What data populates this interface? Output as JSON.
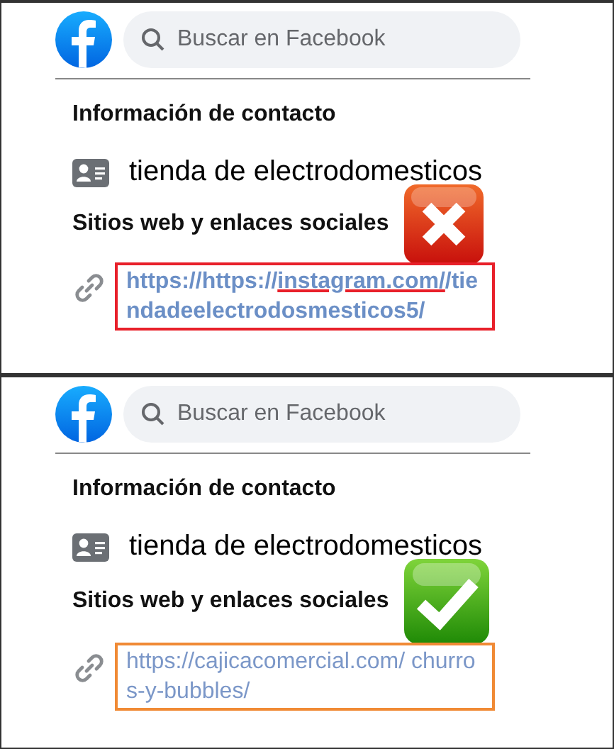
{
  "panels": [
    {
      "search": {
        "placeholder": "Buscar en Facebook"
      },
      "heading": "Información de contacto",
      "category": "tienda de electrodomesticos",
      "links_heading": "Sitios web y enlaces sociales",
      "correct": false,
      "link": {
        "bold": true,
        "parts": [
          {
            "text": "https://https://",
            "underlined": false
          },
          {
            "text": "instagram.com/",
            "underlined": true
          },
          {
            "text": "/tiendadeelectrodosmesticos5/",
            "underlined": false
          }
        ]
      }
    },
    {
      "search": {
        "placeholder": "Buscar en Facebook"
      },
      "heading": "Información de contacto",
      "category": "tienda de electrodomesticos",
      "links_heading": "Sitios web y enlaces sociales",
      "correct": true,
      "link": {
        "bold": false,
        "parts": [
          {
            "text": "https://cajicacomercial.com/ churros-y-bubbles/",
            "underlined": false
          }
        ]
      }
    }
  ]
}
